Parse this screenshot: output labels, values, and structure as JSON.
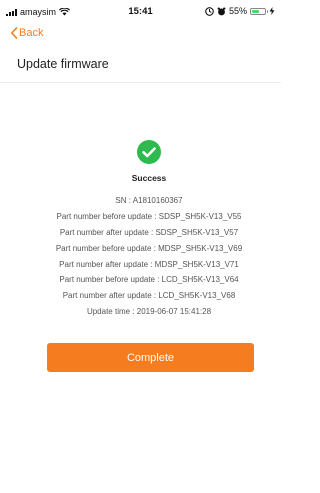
{
  "status_bar": {
    "carrier": "amaysim",
    "time": "15:41",
    "battery_percent": "55%",
    "battery_level": 0.55
  },
  "header": {
    "back_label": "Back",
    "title": "Update firmware"
  },
  "result": {
    "status_label": "Success",
    "status_color": "#2dbb4d",
    "details": [
      "SN : A1810160367",
      "Part number before update : SDSP_SH5K-V13_V55",
      "Part number after update : SDSP_SH5K-V13_V57",
      "Part number before update : MDSP_SH5K-V13_V69",
      "Part number after update : MDSP_SH5K-V13_V71",
      "Part number before update : LCD_SH5K-V13_V64",
      "Part number after update : LCD_SH5K-V13_V68",
      "Update time : 2019-06-07 15:41:28"
    ]
  },
  "actions": {
    "complete_label": "Complete"
  },
  "colors": {
    "accent": "#f57c1f",
    "success": "#2dbb4d"
  },
  "icons": [
    "signal-icon",
    "wifi-icon",
    "lock-icon",
    "alarm-icon",
    "battery-icon",
    "charge-icon",
    "chevron-left-icon",
    "checkmark-circle-icon"
  ]
}
